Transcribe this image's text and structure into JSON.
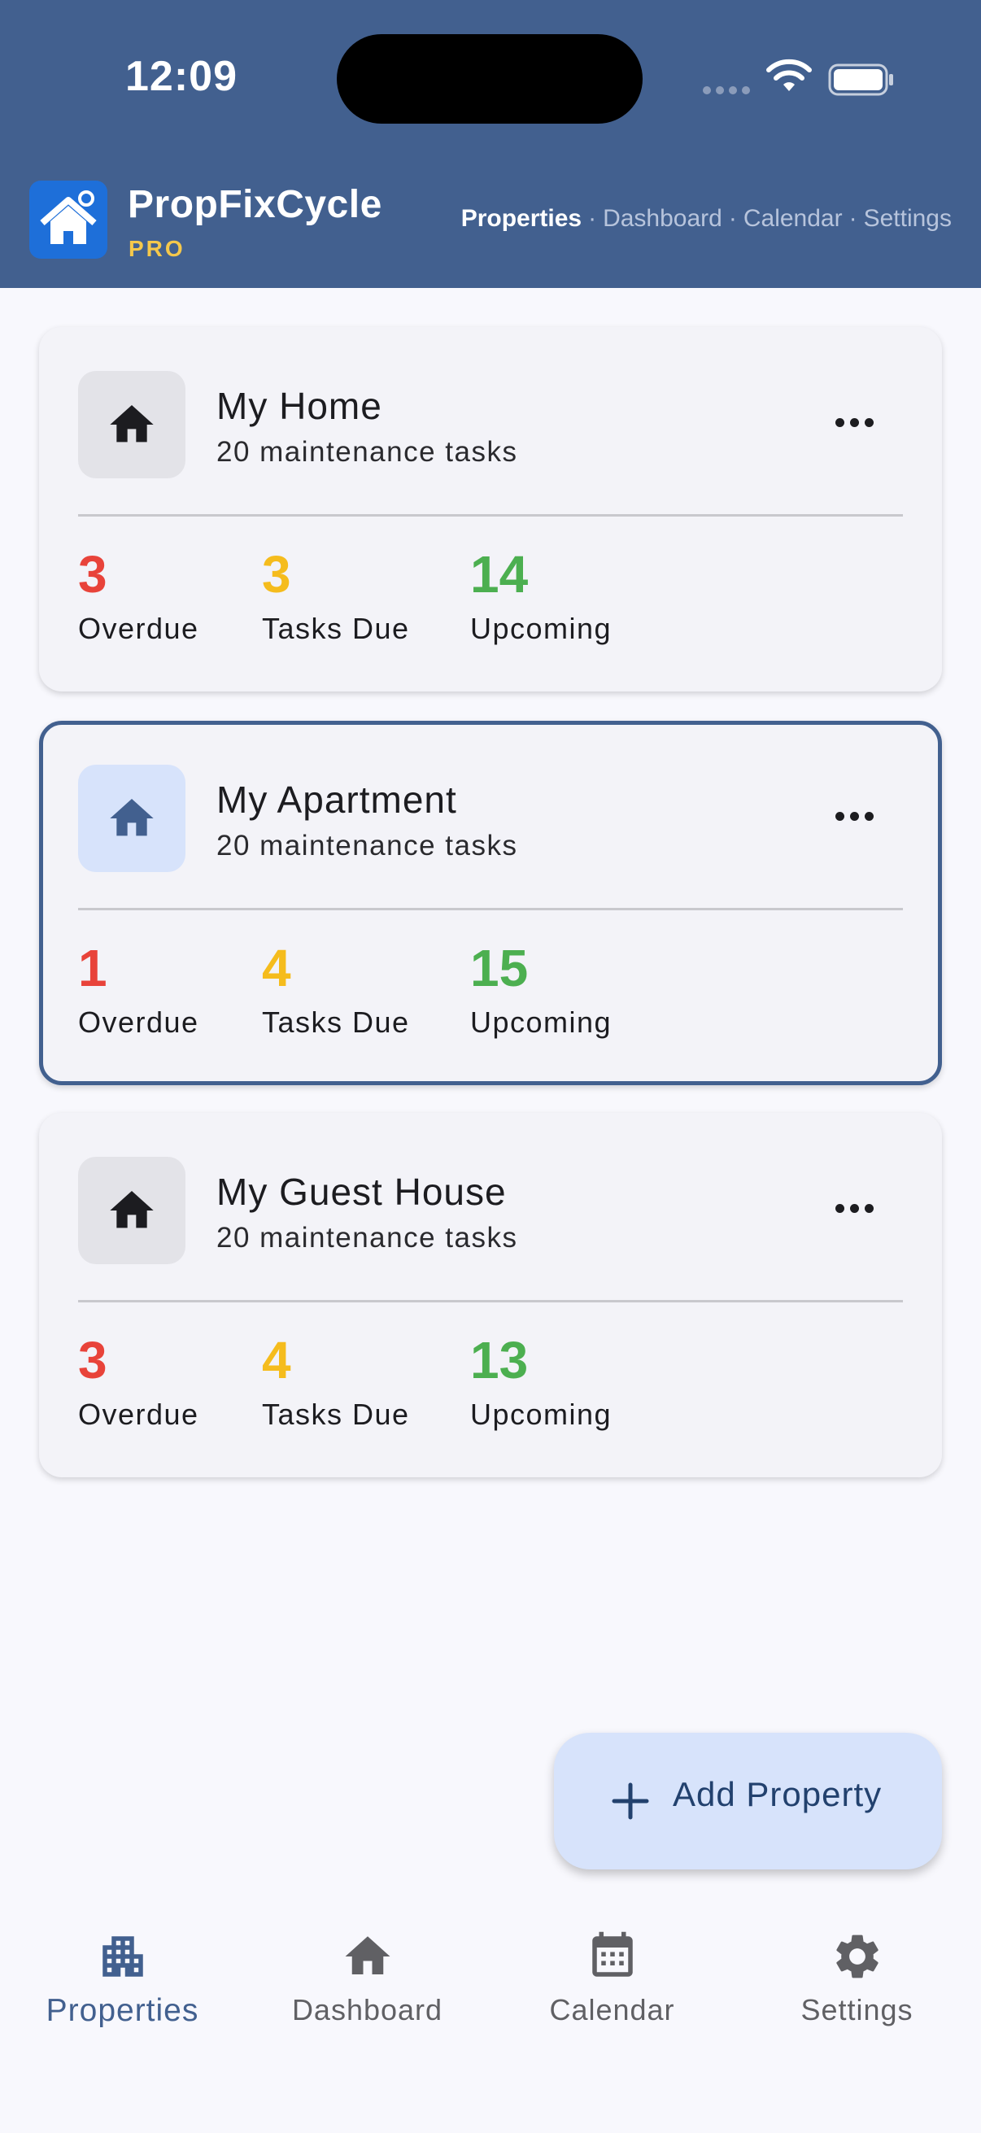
{
  "status_bar": {
    "time": "12:09"
  },
  "app": {
    "name": "PropFixCycle",
    "badge": "PRO"
  },
  "top_nav": {
    "items": [
      "Properties",
      "Dashboard",
      "Calendar",
      "Settings"
    ],
    "separator": "·",
    "active": "Properties"
  },
  "properties": [
    {
      "name": "My Home",
      "subtitle": "20 maintenance tasks",
      "overdue": "3",
      "due": "3",
      "upcoming": "14",
      "selected": false
    },
    {
      "name": "My Apartment",
      "subtitle": "20 maintenance tasks",
      "overdue": "1",
      "due": "4",
      "upcoming": "15",
      "selected": true
    },
    {
      "name": "My Guest House",
      "subtitle": "20 maintenance tasks",
      "overdue": "3",
      "due": "4",
      "upcoming": "13",
      "selected": false
    }
  ],
  "stat_labels": {
    "overdue": "Overdue",
    "due": "Tasks Due",
    "upcoming": "Upcoming"
  },
  "fab": {
    "label": "Add Property"
  },
  "bottom_nav": {
    "items": [
      {
        "label": "Properties",
        "icon": "apartment-building-icon",
        "active": true
      },
      {
        "label": "Dashboard",
        "icon": "home-icon",
        "active": false
      },
      {
        "label": "Calendar",
        "icon": "calendar-icon",
        "active": false
      },
      {
        "label": "Settings",
        "icon": "gear-icon",
        "active": false
      }
    ]
  },
  "colors": {
    "header": "#42608f",
    "overdue": "#e8433a",
    "due": "#f5bc1d",
    "upcoming": "#4caf50",
    "badge": "#f5c84b",
    "selected_border": "#42608f"
  }
}
